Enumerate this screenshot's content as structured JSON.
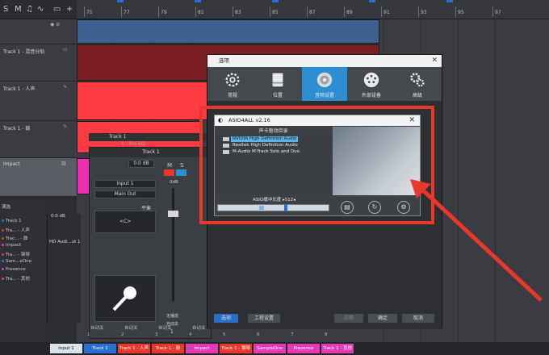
{
  "toolbar": {
    "icons": [
      "solo-icon",
      "mute-icon",
      "instrument-icon",
      "automation-icon",
      "folder-icon",
      "add-icon"
    ]
  },
  "ruler": {
    "ticks": [
      "75",
      "77",
      "79",
      "81",
      "83",
      "85",
      "87",
      "89",
      "91",
      "93",
      "95",
      "97"
    ]
  },
  "tracks": [
    {
      "name": "Track 1 - 混音分轨"
    },
    {
      "name": "Track 1 - 人声"
    },
    {
      "name": "Track 1 - 鼓"
    },
    {
      "name": "Impact"
    }
  ],
  "console_list": {
    "header": "满选",
    "items": [
      {
        "label": "Track 1",
        "color": "#2a6fd6"
      },
      {
        "label": "Tra... - 人声",
        "color": "#e8372b"
      },
      {
        "label": "Trac... - 鼓",
        "color": "#e8372b"
      },
      {
        "label": "Impact",
        "color": "#e23ab5"
      },
      {
        "label": "Tra... - 钢琴",
        "color": "#e8372b"
      },
      {
        "label": "Sam...eOne",
        "color": "#2a6fd6"
      },
      {
        "label": "Presence",
        "color": "#e23ab5"
      },
      {
        "label": "Tra... - 其他",
        "color": "#e23ab5"
      }
    ]
  },
  "mixer": {
    "hd_audio": "HD Audi...ut 1",
    "db_readout": "0.0 dB"
  },
  "strip": {
    "insert_label": "Track 1",
    "insert_plugin": "1 - Pro EQ",
    "title": "Track 1",
    "db": "0.0 dB",
    "input": "Input 1",
    "output": "Main Out",
    "pan": "平衡",
    "pan_value": "<C>",
    "m": "M",
    "s": "S",
    "fader_db": "0dB",
    "auto": "自动关",
    "channel_no": "1",
    "lock": "无播放"
  },
  "dialog": {
    "title": "选项",
    "tabs": [
      {
        "label": "常规",
        "icon": "gear-icon"
      },
      {
        "label": "位置",
        "icon": "drive-icon"
      },
      {
        "label": "音频设置",
        "icon": "speaker-icon"
      },
      {
        "label": "外部设备",
        "icon": "midi-icon"
      },
      {
        "label": "高级",
        "icon": "gears-icon"
      }
    ],
    "ok": "确定",
    "apply": "应用",
    "cancel": "取消",
    "footer_left": "选项",
    "footer_song": "工程设置"
  },
  "asio": {
    "title": "ASIO4ALL v2.16",
    "list_header": "声卡驱动目录",
    "devices": [
      {
        "label": "NVIDIA High Definition Audio",
        "selected": true
      },
      {
        "label": "Realtek High Definition Audio",
        "selected": false
      },
      {
        "label": "M-Audio M-Track Solo and Duo",
        "selected": false
      }
    ],
    "buffer_label": "ASIO缓冲长度 ▸512◂",
    "buffer_fraction": 0.6
  },
  "channels": [
    {
      "num": "1",
      "label": "Track 1",
      "color": "#2a6fd6"
    },
    {
      "num": "2",
      "label": "Track 1 - 人声",
      "color": "#e8372b"
    },
    {
      "num": "3",
      "label": "Track 1 - 鼓",
      "color": "#e8372b"
    },
    {
      "num": "4",
      "label": "Impact",
      "color": "#e23ab5"
    },
    {
      "num": "5",
      "label": "Track 1 - 钢琴",
      "color": "#e8372b"
    },
    {
      "num": "6",
      "label": "SampleOne",
      "color": "#e23ab5"
    },
    {
      "num": "7",
      "label": "Presence",
      "color": "#e23ab5"
    },
    {
      "num": "8",
      "label": "Track 1 - 其他",
      "color": "#e23ab5"
    }
  ],
  "bottom_input": "Input 1",
  "auto_labels": [
    "自动关",
    "自动关",
    "自动关",
    "自动关"
  ]
}
